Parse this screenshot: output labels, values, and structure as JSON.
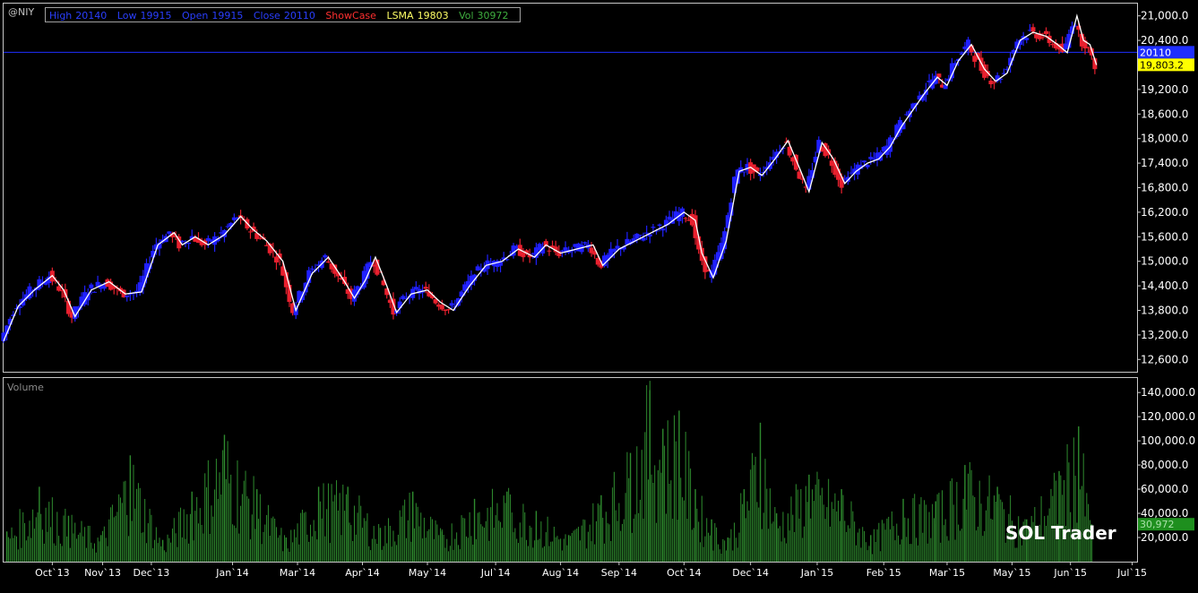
{
  "symbol": "@NIY",
  "legend": {
    "high_label": "High",
    "high_value": "20140",
    "low_label": "Low",
    "low_value": "19915",
    "open_label": "Open",
    "open_value": "19915",
    "close_label": "Close",
    "close_value": "20110",
    "showcase_label": "ShowCase",
    "lsma_label": "LSMA",
    "lsma_value": "19803",
    "vol_label": "Vol",
    "vol_value": "30972"
  },
  "volume_title": "Volume",
  "watermark": "SOL Trader",
  "colors": {
    "background": "#000000",
    "up_bar": "#2020ff",
    "down_bar": "#e8202e",
    "lsma_line": "#ffffff",
    "last_price_marker": "#1f2fff",
    "lsma_marker": "#ffff00",
    "volume_bar": "#2e8b2e",
    "volume_marker": "#1e8f1e",
    "legend_high": "#2a3fff",
    "legend_low": "#2a3fff",
    "legend_open": "#2a3fff",
    "legend_close": "#2a3fff",
    "legend_showcase": "#ff3030",
    "legend_lsma": "#ffff66",
    "legend_vol": "#3fae3f"
  },
  "chart_data": [
    {
      "type": "ohlc",
      "name": "price",
      "ylim": [
        12300,
        21300
      ],
      "y_ticks": [
        12600,
        13200,
        13800,
        14400,
        15000,
        15600,
        16200,
        16800,
        17400,
        18000,
        18600,
        19200,
        19800,
        20400,
        21000
      ],
      "y_tick_labels": [
        "12,600.0",
        "13,200.0",
        "13,800.0",
        "14,400.0",
        "15,000.0",
        "15,600.0",
        "16,200.0",
        "16,800.0",
        "17,400.0",
        "18,000.0",
        "18,600.0",
        "19,200.0",
        "19,800.0",
        "20,400.0",
        "21,000.0"
      ],
      "x_tick_labels": [
        "Oct`13",
        "Nov`13",
        "Dec`13",
        "Jan`14",
        "Mar`14",
        "Apr`14",
        "May`14",
        "Jul`14",
        "Aug`14",
        "Sep`14",
        "Oct`14",
        "Dec`14",
        "Jan`15",
        "Feb`15",
        "Mar`15",
        "May`15",
        "Jun`15",
        "Jul`15"
      ],
      "x_range": [
        "2013-09-01",
        "2015-07-31"
      ],
      "x_tick_dates": [
        "2013-10-01",
        "2013-11-01",
        "2013-12-01",
        "2014-01-20",
        "2014-03-01",
        "2014-04-10",
        "2014-05-20",
        "2014-07-01",
        "2014-08-10",
        "2014-09-15",
        "2014-10-25",
        "2014-12-05",
        "2015-01-15",
        "2015-02-25",
        "2015-04-05",
        "2015-05-15",
        "2015-06-20",
        "2015-07-28"
      ],
      "last_price": 20110,
      "last_price_label": "20110",
      "lsma_value": 19803.2,
      "lsma_label": "19,803.2",
      "series": [
        {
          "name": "LSMA",
          "type": "line",
          "points": [
            [
              "2013-09-01",
              13050
            ],
            [
              "2013-09-10",
              13900
            ],
            [
              "2013-09-20",
              14300
            ],
            [
              "2013-10-01",
              14650
            ],
            [
              "2013-10-08",
              14300
            ],
            [
              "2013-10-15",
              13650
            ],
            [
              "2013-10-25",
              14300
            ],
            [
              "2013-11-05",
              14500
            ],
            [
              "2013-11-15",
              14200
            ],
            [
              "2013-11-25",
              14250
            ],
            [
              "2013-12-05",
              15400
            ],
            [
              "2013-12-15",
              15700
            ],
            [
              "2013-12-20",
              15400
            ],
            [
              "2013-12-28",
              15600
            ],
            [
              "2014-01-05",
              15400
            ],
            [
              "2014-01-15",
              15650
            ],
            [
              "2014-01-25",
              16100
            ],
            [
              "2014-02-01",
              15800
            ],
            [
              "2014-02-10",
              15500
            ],
            [
              "2014-02-20",
              15000
            ],
            [
              "2014-02-28",
              13800
            ],
            [
              "2014-03-10",
              14700
            ],
            [
              "2014-03-20",
              15100
            ],
            [
              "2014-03-30",
              14500
            ],
            [
              "2014-04-05",
              14100
            ],
            [
              "2014-04-12",
              14550
            ],
            [
              "2014-04-18",
              15100
            ],
            [
              "2014-04-25",
              14400
            ],
            [
              "2014-05-01",
              13750
            ],
            [
              "2014-05-10",
              14200
            ],
            [
              "2014-05-20",
              14300
            ],
            [
              "2014-05-28",
              14000
            ],
            [
              "2014-06-05",
              13800
            ],
            [
              "2014-06-15",
              14400
            ],
            [
              "2014-06-25",
              14900
            ],
            [
              "2014-07-05",
              15000
            ],
            [
              "2014-07-15",
              15300
            ],
            [
              "2014-07-25",
              15100
            ],
            [
              "2014-08-01",
              15400
            ],
            [
              "2014-08-10",
              15200
            ],
            [
              "2014-08-20",
              15300
            ],
            [
              "2014-08-30",
              15400
            ],
            [
              "2014-09-05",
              14900
            ],
            [
              "2014-09-15",
              15300
            ],
            [
              "2014-09-25",
              15500
            ],
            [
              "2014-10-05",
              15700
            ],
            [
              "2014-10-15",
              15900
            ],
            [
              "2014-10-25",
              16200
            ],
            [
              "2014-11-01",
              16000
            ],
            [
              "2014-11-05",
              15200
            ],
            [
              "2014-11-12",
              14600
            ],
            [
              "2014-11-20",
              15500
            ],
            [
              "2014-11-28",
              17200
            ],
            [
              "2014-12-05",
              17300
            ],
            [
              "2014-12-12",
              17100
            ],
            [
              "2014-12-20",
              17500
            ],
            [
              "2014-12-28",
              17950
            ],
            [
              "2015-01-05",
              17200
            ],
            [
              "2015-01-10",
              16700
            ],
            [
              "2015-01-18",
              17900
            ],
            [
              "2015-01-25",
              17500
            ],
            [
              "2015-02-01",
              16900
            ],
            [
              "2015-02-08",
              17200
            ],
            [
              "2015-02-15",
              17400
            ],
            [
              "2015-02-22",
              17500
            ],
            [
              "2015-03-01",
              17800
            ],
            [
              "2015-03-08",
              18300
            ],
            [
              "2015-03-15",
              18700
            ],
            [
              "2015-03-22",
              19100
            ],
            [
              "2015-03-30",
              19500
            ],
            [
              "2015-04-05",
              19300
            ],
            [
              "2015-04-12",
              19900
            ],
            [
              "2015-04-20",
              20300
            ],
            [
              "2015-04-28",
              19700
            ],
            [
              "2015-05-05",
              19400
            ],
            [
              "2015-05-12",
              19600
            ],
            [
              "2015-05-20",
              20400
            ],
            [
              "2015-05-28",
              20600
            ],
            [
              "2015-06-05",
              20500
            ],
            [
              "2015-06-12",
              20300
            ],
            [
              "2015-06-18",
              20100
            ],
            [
              "2015-06-24",
              21000
            ],
            [
              "2015-06-28",
              20400
            ],
            [
              "2015-07-02",
              20300
            ],
            [
              "2015-07-06",
              19800
            ]
          ]
        }
      ]
    },
    {
      "type": "bar",
      "name": "Volume",
      "ylim": [
        0,
        152000
      ],
      "y_ticks": [
        20000,
        40000,
        60000,
        80000,
        100000,
        120000,
        140000
      ],
      "y_tick_labels": [
        "20,000.0",
        "40,000.0",
        "60,000.0",
        "80,000.0",
        "100,000.0",
        "120,000.0",
        "140,000.0"
      ],
      "last_value": 30972,
      "last_value_label": "30,972",
      "x": [
        "2013-09-03",
        "2013-09-23",
        "2013-10-11",
        "2013-10-31",
        "2013-11-18",
        "2013-12-08",
        "2013-12-26",
        "2014-01-15",
        "2014-02-04",
        "2014-02-22",
        "2014-03-14",
        "2014-04-01",
        "2014-04-21",
        "2014-05-11",
        "2014-05-29",
        "2014-06-18",
        "2014-07-08",
        "2014-07-26",
        "2014-08-15",
        "2014-09-04",
        "2014-09-22",
        "2014-10-04",
        "2014-10-12",
        "2014-10-22",
        "2014-11-01",
        "2014-11-11",
        "2014-11-21",
        "2014-12-01",
        "2014-12-11",
        "2014-12-21",
        "2015-01-10",
        "2015-01-30",
        "2015-02-17",
        "2015-03-09",
        "2015-03-29",
        "2015-04-16",
        "2015-05-06",
        "2015-05-24",
        "2015-06-13",
        "2015-06-25",
        "2015-07-03"
      ],
      "values": [
        25000,
        62000,
        38000,
        22000,
        88000,
        18000,
        58000,
        105000,
        60000,
        20000,
        62000,
        62000,
        28000,
        58000,
        25000,
        52000,
        58000,
        42000,
        22000,
        55000,
        90000,
        142000,
        110000,
        125000,
        60000,
        35000,
        20000,
        60000,
        115000,
        40000,
        72000,
        60000,
        22000,
        52000,
        50000,
        80000,
        62000,
        35000,
        75000,
        112000,
        30972
      ]
    }
  ]
}
